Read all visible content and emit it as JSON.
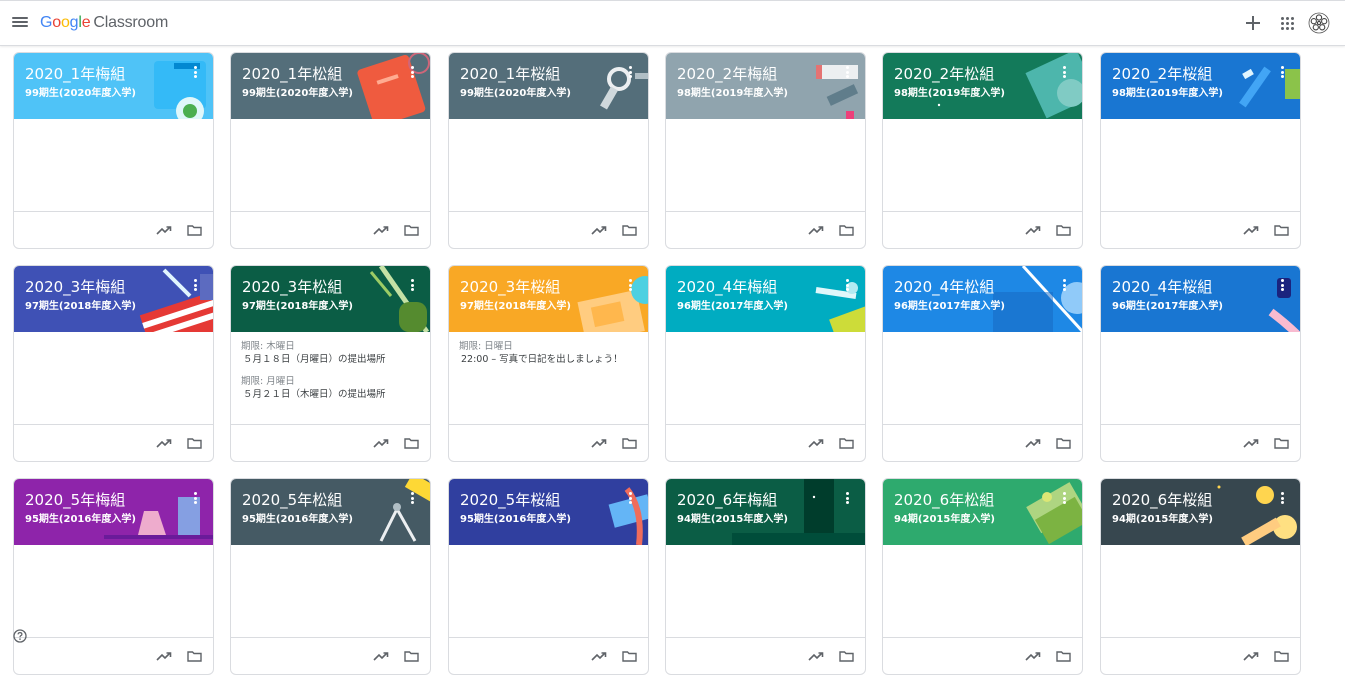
{
  "header": {
    "logo_google": "Google",
    "logo_product": "Classroom"
  },
  "icons": {
    "menu": "hamburger-menu-icon",
    "create": "plus-icon",
    "apps": "apps-grid-icon",
    "account": "avatar",
    "help": "help-icon",
    "stream": "trending-up-icon",
    "drive": "folder-icon"
  },
  "colors": {
    "logo_blue": "#4285f4",
    "logo_red": "#ea4335",
    "logo_yellow": "#fbbc05",
    "logo_green": "#34a853"
  },
  "classes": [
    {
      "title": "2020_1年梅組",
      "section": "99期生(2020年度入学)",
      "color": "#4fc3f7",
      "art": "camera",
      "tasks": []
    },
    {
      "title": "2020_1年松組",
      "section": "99期生(2020年度入学)",
      "color": "#546e7a",
      "art": "book",
      "tasks": []
    },
    {
      "title": "2020_1年桜組",
      "section": "99期生(2020年度入学)",
      "color": "#546e7a",
      "art": "tools",
      "tasks": []
    },
    {
      "title": "2020_2年梅組",
      "section": "98期生(2019年度入学)",
      "color": "#90a4ae",
      "art": "paint",
      "tasks": []
    },
    {
      "title": "2020_2年松組",
      "section": "98期生(2019年度入学)",
      "color": "#137a5a",
      "art": "paper",
      "tasks": []
    },
    {
      "title": "2020_2年桜組",
      "section": "98期生(2019年度入学)",
      "color": "#1976d2",
      "art": "pencil",
      "tasks": []
    },
    {
      "title": "2020_3年梅組",
      "section": "97期生(2018年度入学)",
      "color": "#3f51b5",
      "art": "flag",
      "tasks": []
    },
    {
      "title": "2020_3年松組",
      "section": "97期生(2018年度入学)",
      "color": "#0b5d45",
      "art": "guitar",
      "tasks": [
        {
          "due": "期限: 木曜日",
          "title": "５月１８日（月曜日）の提出場所"
        },
        {
          "due": "期限: 月曜日",
          "title": "５月２１日（木曜日）の提出場所"
        }
      ]
    },
    {
      "title": "2020_3年桜組",
      "section": "97期生(2018年度入学)",
      "color": "#f9a825",
      "art": "map",
      "tasks": [
        {
          "due": "期限: 日曜日",
          "title": "22:00 – 写真で日記を出しましょう！"
        }
      ]
    },
    {
      "title": "2020_4年梅組",
      "section": "96期生(2017年度入学)",
      "color": "#00acc1",
      "art": "ruler",
      "tasks": []
    },
    {
      "title": "2020_4年松組",
      "section": "96期生(2017年度入学)",
      "color": "#1e88e5",
      "art": "globe",
      "tasks": []
    },
    {
      "title": "2020_4年桜組",
      "section": "96期生(2017年度入学)",
      "color": "#1976d2",
      "art": "feather",
      "tasks": []
    },
    {
      "title": "2020_5年梅組",
      "section": "95期生(2016年度入学)",
      "color": "#8e24aa",
      "art": "flask",
      "tasks": []
    },
    {
      "title": "2020_5年松組",
      "section": "95期生(2016年度入学)",
      "color": "#455a64",
      "art": "compass",
      "tasks": []
    },
    {
      "title": "2020_5年桜組",
      "section": "95期生(2016年度入学)",
      "color": "#303f9f",
      "art": "ribbon",
      "tasks": []
    },
    {
      "title": "2020_6年梅組",
      "section": "94期生(2015年度入学)",
      "color": "#0b5d45",
      "art": "forest",
      "tasks": []
    },
    {
      "title": "2020_6年松組",
      "section": "94期(2015年度入学)",
      "color": "#2eaa6e",
      "art": "money",
      "tasks": []
    },
    {
      "title": "2020_6年桜組",
      "section": "94期(2015年度入学)",
      "color": "#37474f",
      "art": "space",
      "tasks": []
    }
  ]
}
